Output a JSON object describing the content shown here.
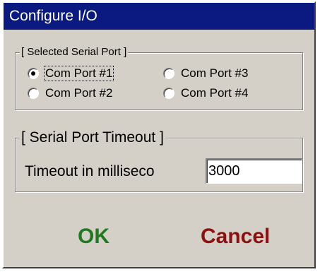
{
  "window": {
    "title": "Configure I/O"
  },
  "serial_port_group": {
    "legend": "[ Selected Serial Port ]",
    "options": [
      {
        "label": "Com Port #1",
        "checked": true
      },
      {
        "label": "Com Port #2",
        "checked": false
      },
      {
        "label": "Com Port #3",
        "checked": false
      },
      {
        "label": "Com Port #4",
        "checked": false
      }
    ]
  },
  "timeout_group": {
    "legend": "[ Serial Port Timeout ]",
    "label": "Timeout in milliseco",
    "value": "3000"
  },
  "buttons": {
    "ok_label": "OK",
    "cancel_label": "Cancel"
  },
  "colors": {
    "titlebar": "#0a1a80",
    "dialog_bg": "#d4d0c8",
    "ok_text": "#1f7a1f",
    "cancel_text": "#8b1010"
  }
}
